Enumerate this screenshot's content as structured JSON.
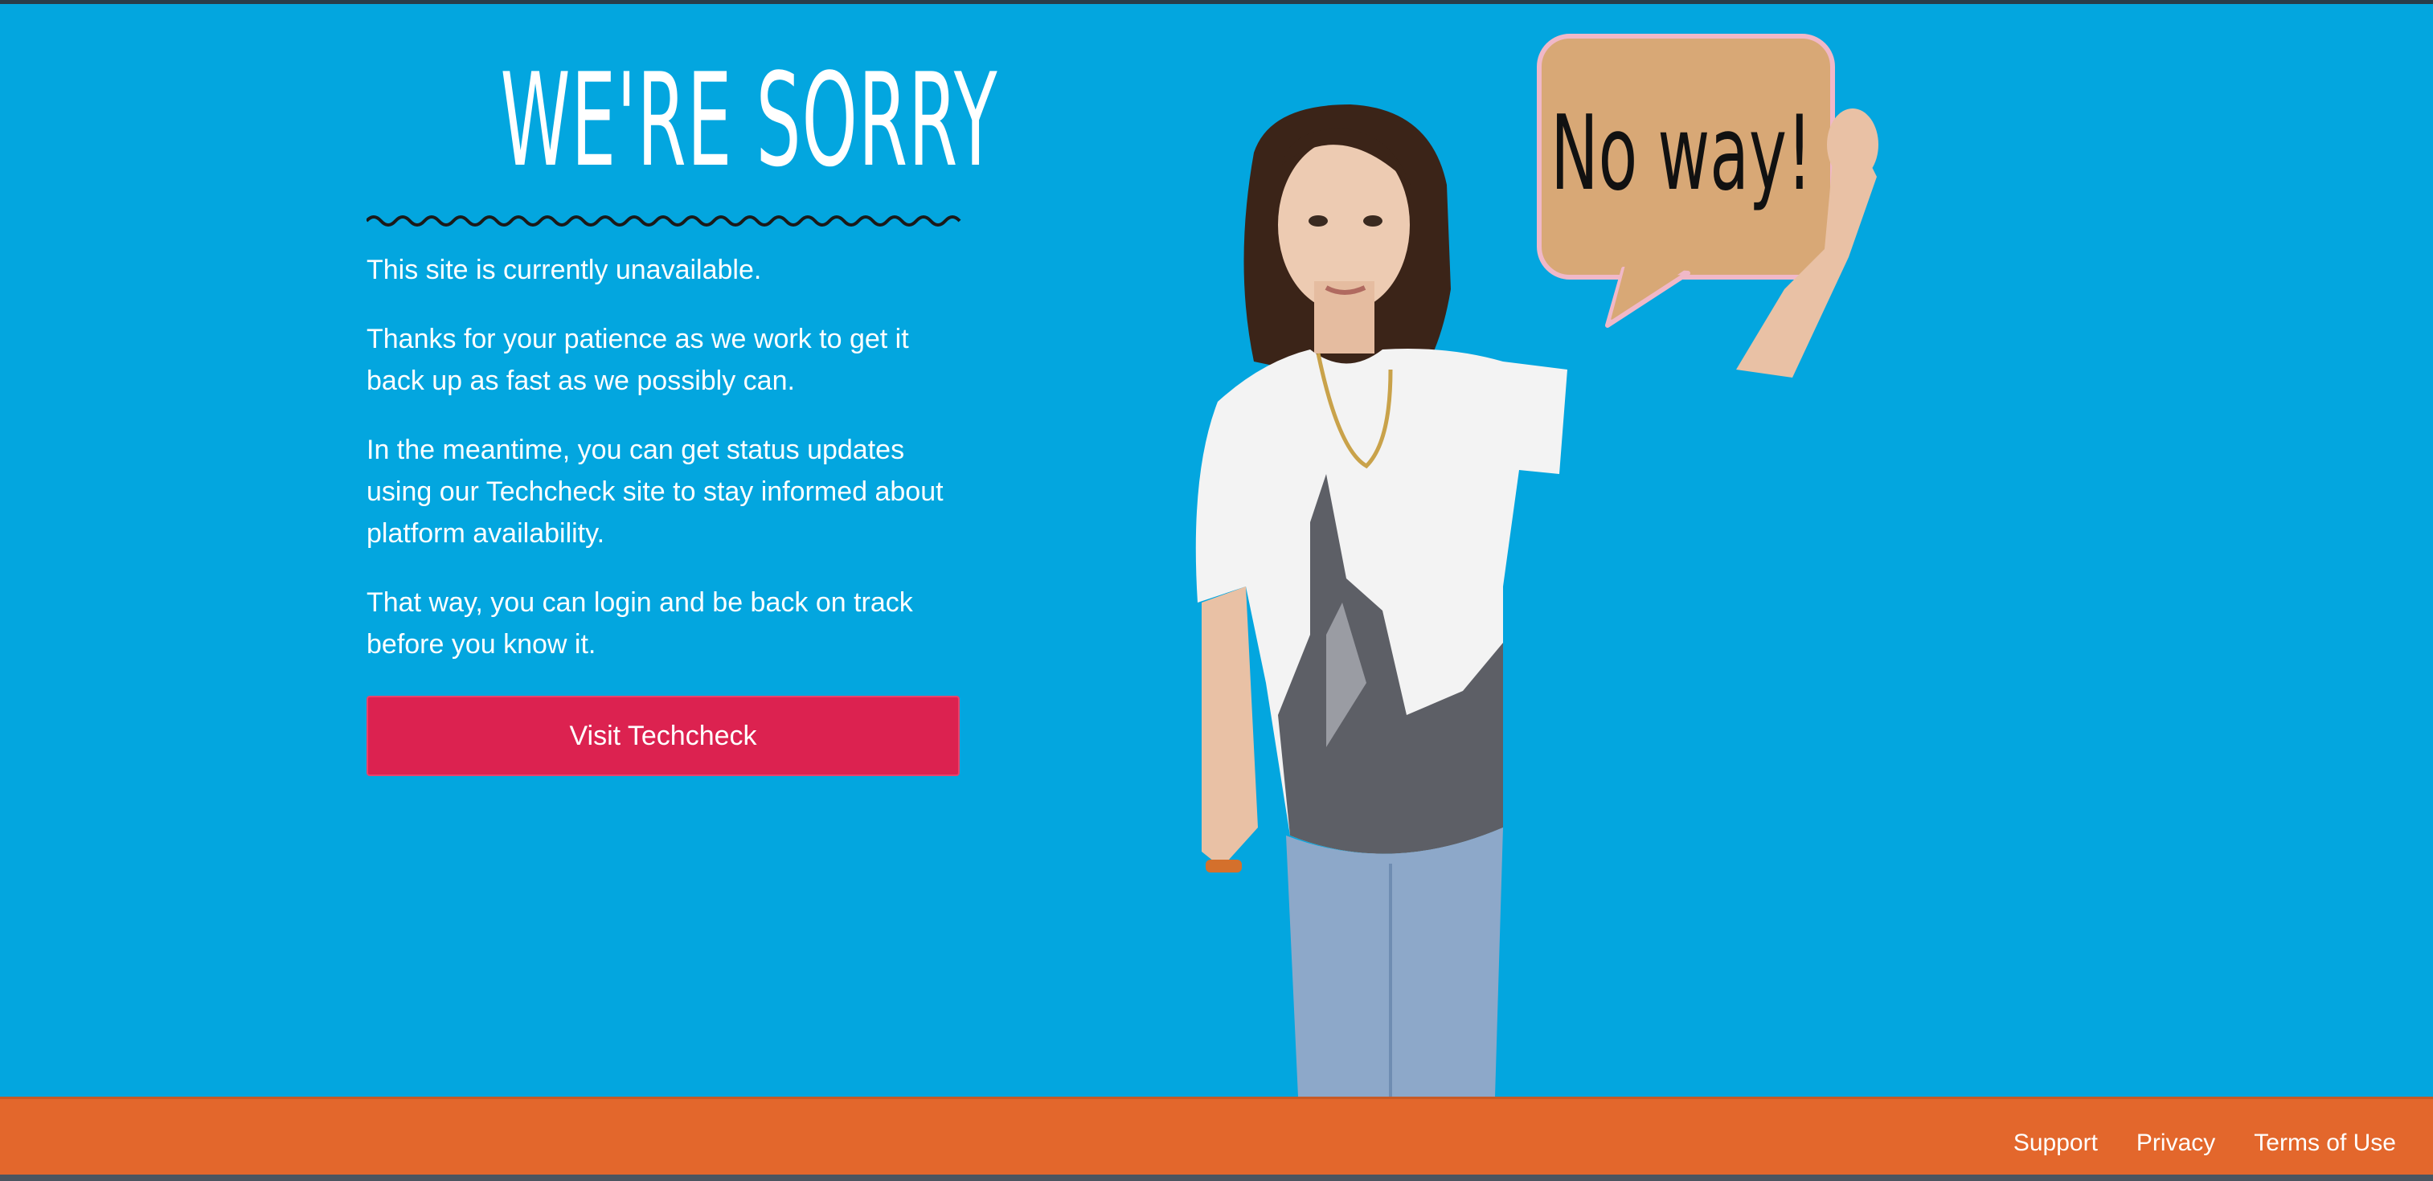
{
  "page": {
    "title": "WE'RE SORRY",
    "paragraphs": [
      "This site is currently unavailable.",
      "Thanks for your patience as we work to get it back up as fast as we possibly can.",
      "In the meantime, you can get status updates using our Techcheck site to stay informed about platform availability.",
      "That way, you can login and be back on track before you know it."
    ],
    "button_label": "Visit Techcheck"
  },
  "hero": {
    "sign_text": "No way!"
  },
  "footer": {
    "links": [
      "Support",
      "Privacy",
      "Terms of Use"
    ]
  },
  "colors": {
    "background": "#03a6df",
    "button": "#dc2250",
    "footer": "#e3672c",
    "sign": "#d8a876"
  }
}
